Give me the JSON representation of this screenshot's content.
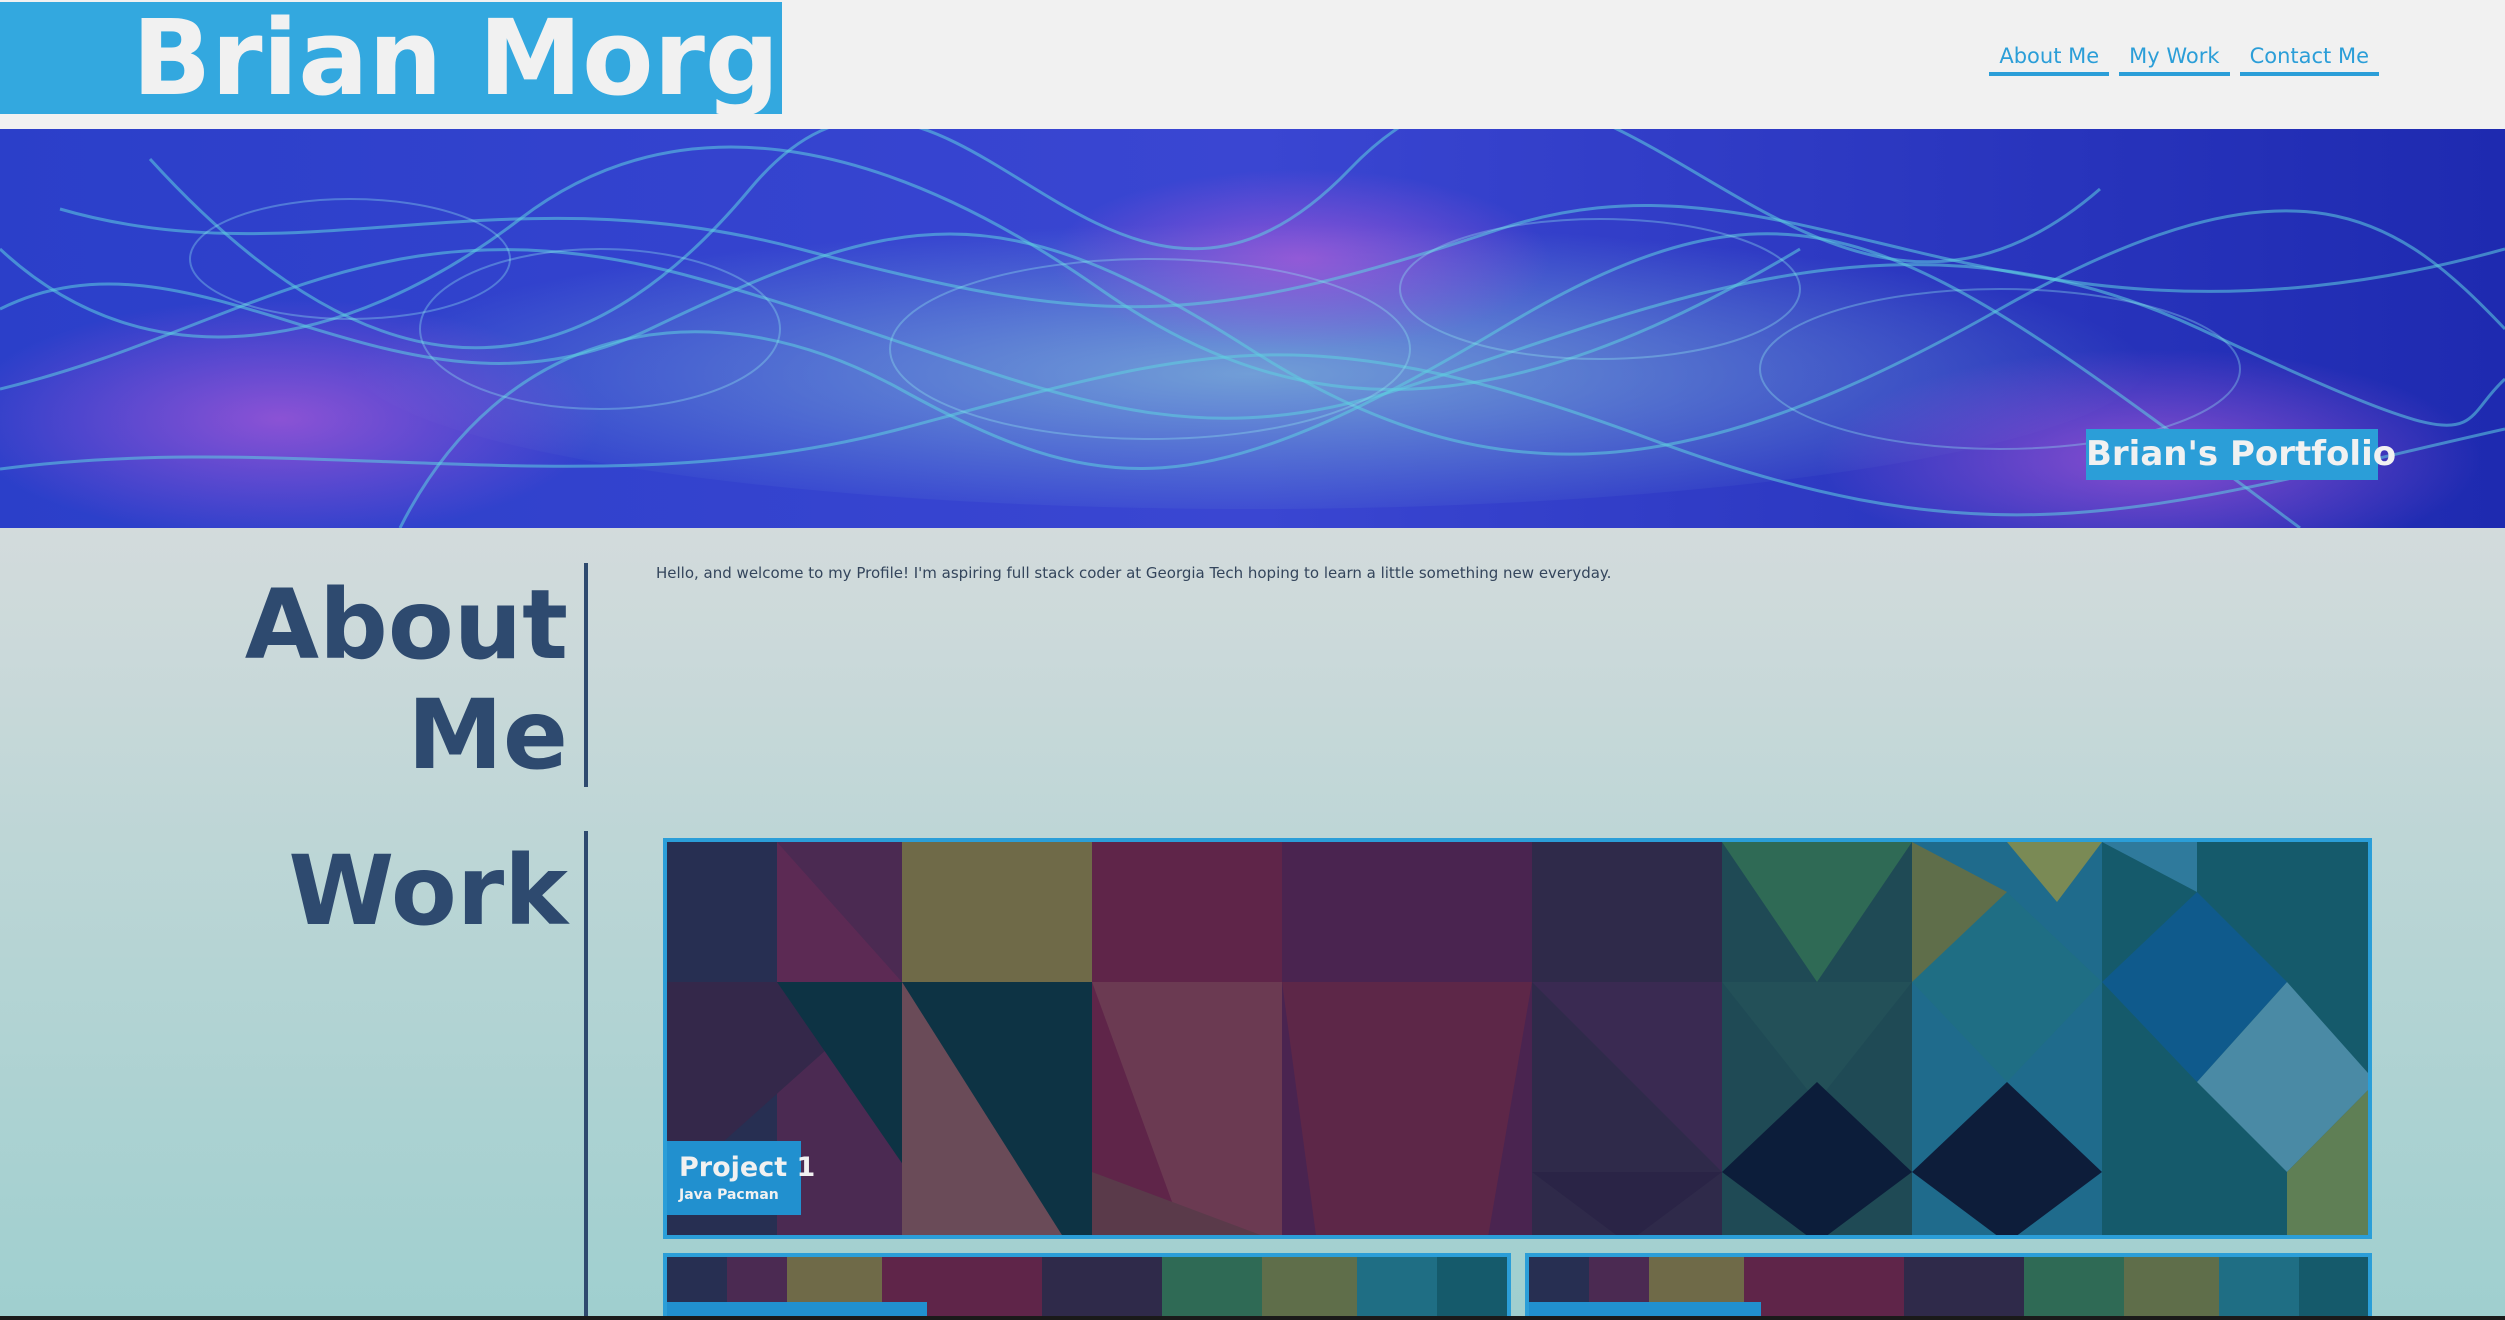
{
  "header": {
    "site_name": "Brian Morgan",
    "nav": [
      {
        "label": "About Me"
      },
      {
        "label": "My Work"
      },
      {
        "label": "Contact Me"
      }
    ]
  },
  "hero": {
    "badge": "Brian's Portfolio"
  },
  "about": {
    "title_line1": "About",
    "title_line2": "Me",
    "text": "Hello, and welcome to my Profile! I'm aspiring full stack coder at Georgia Tech hoping to learn a little something new everyday."
  },
  "work": {
    "title": "Work",
    "projects": [
      {
        "title": "Project 1",
        "subtitle": "Java Pacman"
      }
    ]
  },
  "colors": {
    "accent": "#2b9ed8",
    "heading": "#2e4a6f",
    "header_bg": "#f1f1f1"
  }
}
